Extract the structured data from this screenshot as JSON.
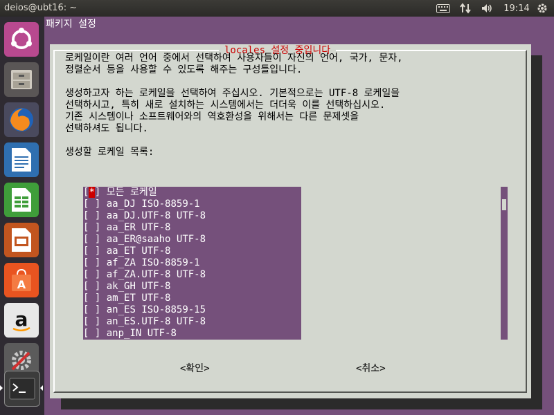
{
  "topbar": {
    "title": "deios@ubt16: ~",
    "time": "19:14",
    "indicators": [
      "keyboard-icon",
      "network-icon",
      "volume-icon",
      "power-gear-icon"
    ]
  },
  "launcher": {
    "items": [
      "ubuntu-dash",
      "files",
      "firefox",
      "libreoffice-writer",
      "libreoffice-calc",
      "libreoffice-impress",
      "ubuntu-software",
      "amazon",
      "system-settings",
      "terminal"
    ]
  },
  "terminal": {
    "title": "패키지 설정",
    "dialog": {
      "title": "locales 설정 중입니다",
      "para1": [
        "로케일이란 여러 언어 중에서 선택하여 사용자들이 자신의 언어, 국가, 문자,",
        "정렬순서 등을 사용할 수 있도록 해주는 구성틀입니다."
      ],
      "para2": [
        "생성하고자 하는 로케일을 선택하여 주십시오. 기본적으로는 UTF-8 로케일을",
        "선택하시고, 특히 새로 설치하는 시스템에서는 더더욱 이를 선택하십시오.",
        "기존 시스템이나 소프트웨어와의 역호환성을 위해서는 다른 문제셋을",
        "선택하셔도 됩니다."
      ],
      "list_label": "생성할 로케일 목록:",
      "items": [
        {
          "checked": true,
          "label": "모든 로케일"
        },
        {
          "checked": false,
          "label": "aa_DJ ISO-8859-1"
        },
        {
          "checked": false,
          "label": "aa_DJ.UTF-8 UTF-8"
        },
        {
          "checked": false,
          "label": "aa_ER UTF-8"
        },
        {
          "checked": false,
          "label": "aa_ER@saaho UTF-8"
        },
        {
          "checked": false,
          "label": "aa_ET UTF-8"
        },
        {
          "checked": false,
          "label": "af_ZA ISO-8859-1"
        },
        {
          "checked": false,
          "label": "af_ZA.UTF-8 UTF-8"
        },
        {
          "checked": false,
          "label": "ak_GH UTF-8"
        },
        {
          "checked": false,
          "label": "am_ET UTF-8"
        },
        {
          "checked": false,
          "label": "an_ES ISO-8859-15"
        },
        {
          "checked": false,
          "label": "an_ES.UTF-8 UTF-8"
        },
        {
          "checked": false,
          "label": "anp_IN UTF-8"
        }
      ],
      "ok": "<확인>",
      "cancel": "<취소>"
    }
  }
}
